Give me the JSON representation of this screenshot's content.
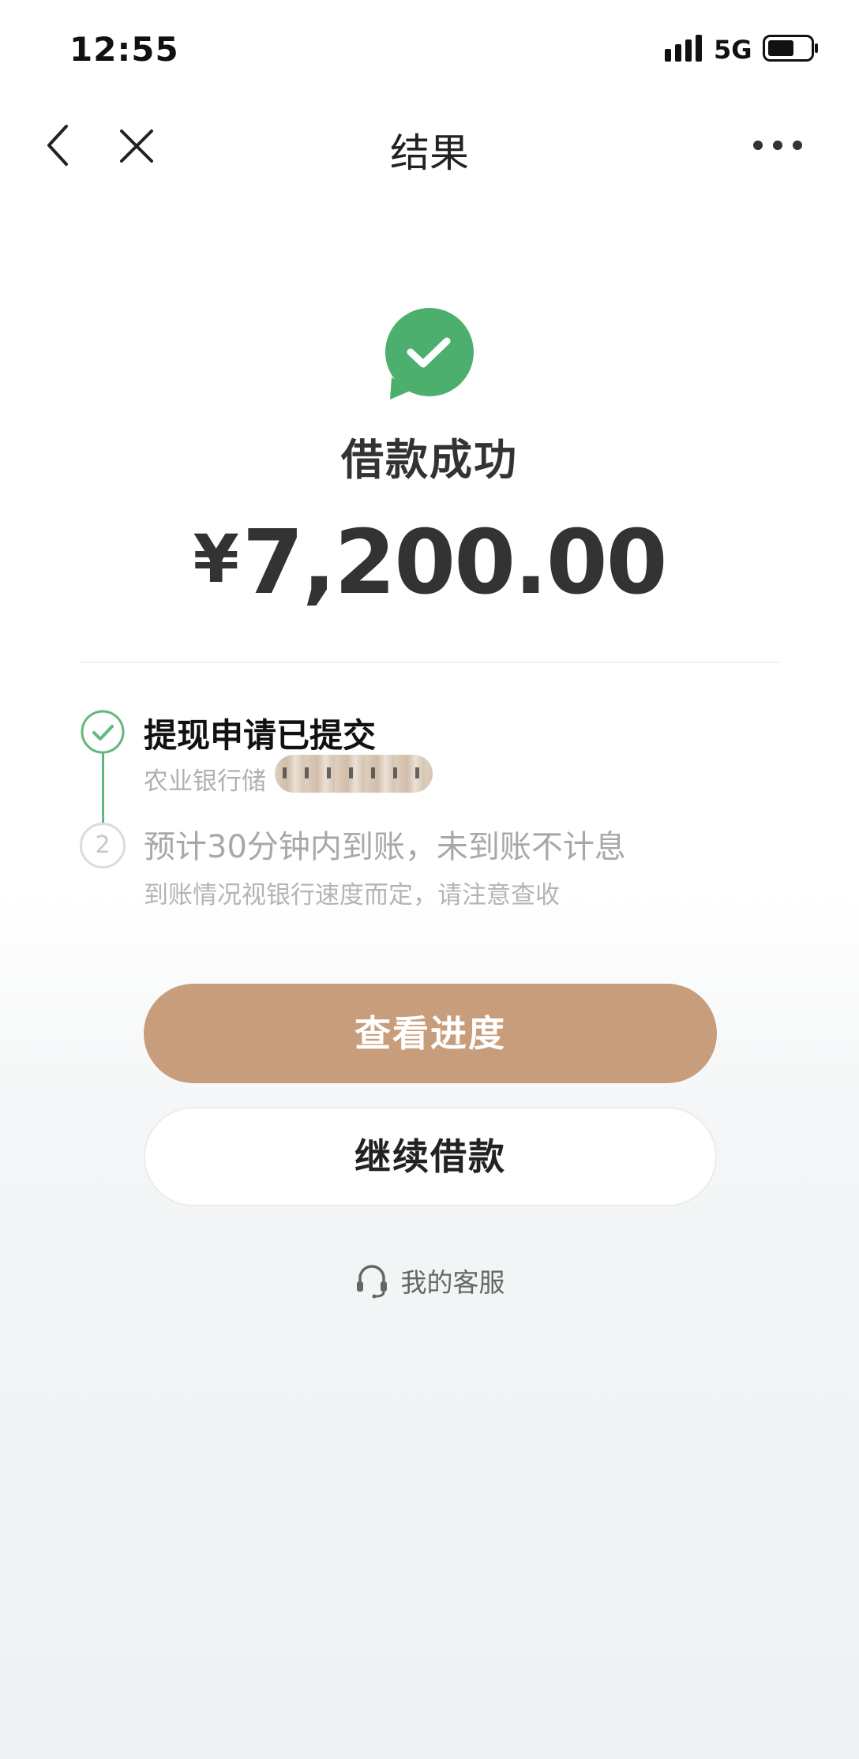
{
  "status_bar": {
    "time": "12:55",
    "network": "5G",
    "icons": [
      "signal-icon",
      "battery-icon"
    ]
  },
  "nav": {
    "title": "结果",
    "icons": [
      "back-icon",
      "close-icon",
      "more-icon"
    ]
  },
  "result": {
    "icon": "success-check-icon",
    "title": "借款成功",
    "currency": "¥",
    "amount": "7,200.00"
  },
  "steps": [
    {
      "title": "提现申请已提交",
      "subtitle": "农业银行储",
      "status": "done",
      "icon": "check-circle-icon"
    },
    {
      "number": "2",
      "title": "预计30分钟内到账，未到账不计息",
      "subtitle": "到账情况视银行速度而定，请注意查收",
      "status": "pending"
    }
  ],
  "buttons": {
    "primary": "查看进度",
    "secondary": "继续借款"
  },
  "service": {
    "icon": "headset-icon",
    "label": "我的客服"
  },
  "colors": {
    "success_green": "#4caf6d",
    "primary_button": "#c89d7b",
    "step_line": "#62b77c"
  }
}
